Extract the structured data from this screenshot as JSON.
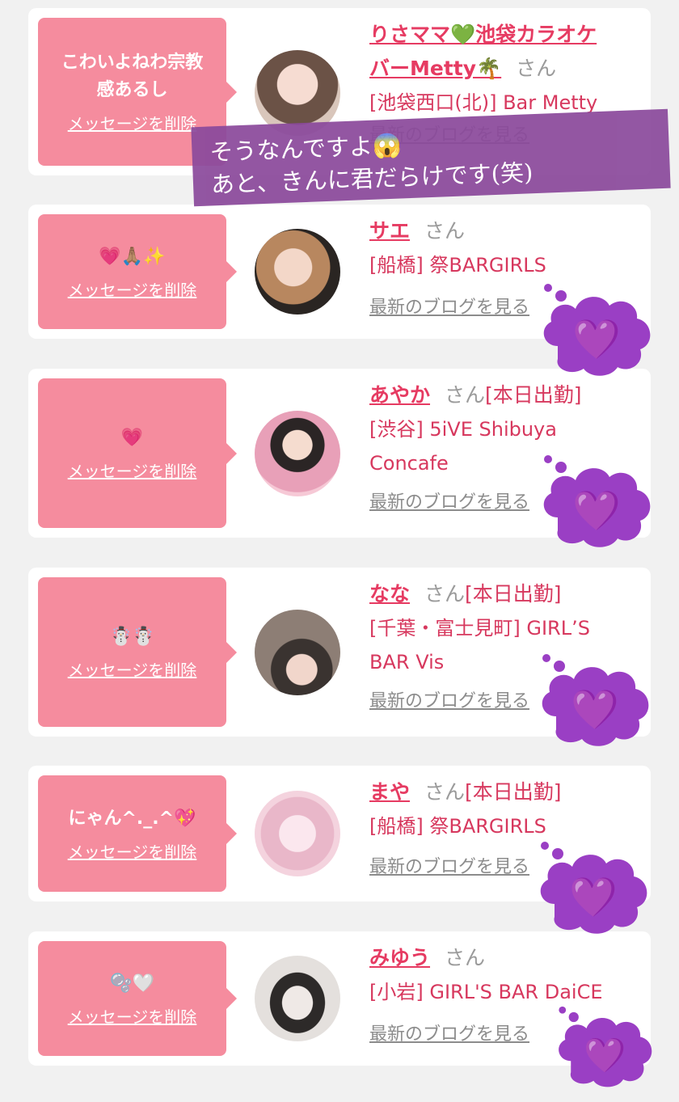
{
  "delete_label": "メッセージを削除",
  "honorific": "さん",
  "blog_label": "最新のブログを見る",
  "caption": {
    "line1": "そうなんですよ😱",
    "line2": "あと、きんに君だらけです(笑)"
  },
  "entries": [
    {
      "message_line1": "こわいよねわ宗教",
      "message_line2": "感あるし",
      "name_line1": "りさママ💚池袋カラオケ",
      "name_line2": "バーMetty🌴",
      "status": "",
      "shop": "[池袋西口(北)] Bar Metty"
    },
    {
      "message_line1": "💗🙏🏽✨",
      "name_line1": "サエ",
      "status": "",
      "shop": "[船橋] 祭BARGIRLS"
    },
    {
      "message_line1": "💗",
      "name_line1": "あやか",
      "status": "[本日出勤]",
      "shop_line1": "[渋谷] 5iVE Shibuya",
      "shop_line2": "Concafe"
    },
    {
      "message_line1": "☃️☃️",
      "name_line1": "なな",
      "status": "[本日出勤]",
      "shop_line1": "[千葉・富士見町] GIRL’S",
      "shop_line2": "BAR Vis"
    },
    {
      "message_line1": "にゃん^._.^💖",
      "name_line1": "まや",
      "status": "[本日出勤]",
      "shop": "[船橋] 祭BARGIRLS"
    },
    {
      "message_line1": "🫧🤍",
      "name_line1": "みゆう",
      "status": "",
      "shop": "[小岩] GIRL'S BAR DaiCE"
    }
  ],
  "colors": {
    "bubble": "#f58c9e",
    "name": "#e63b62",
    "cloud": "#9a3fc4",
    "caption_band": "#8b4a9c"
  }
}
